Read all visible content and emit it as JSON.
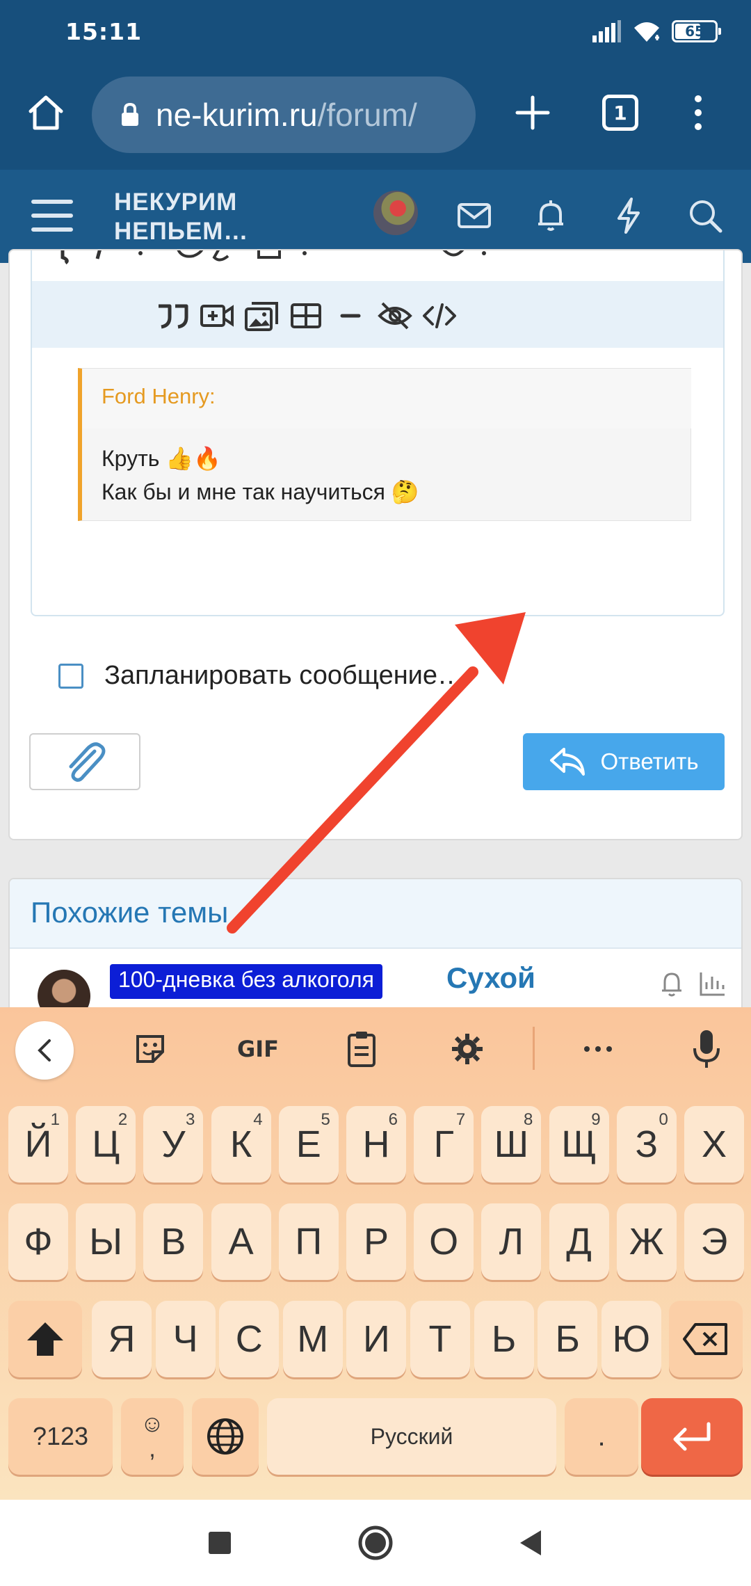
{
  "status": {
    "time": "15:11",
    "battery": "65",
    "battery_level": 0.65
  },
  "browser": {
    "url_host": "ne-kurim.ru",
    "url_path": "/forum/",
    "tab_count": "1"
  },
  "forum": {
    "logo_line1": "НЕКУРИМ",
    "logo_line2": "НЕПЬЕМ…"
  },
  "editor": {
    "quote_author": "Ford Henry:",
    "quote_line1": "Круть 👍🔥",
    "quote_line2": "Как бы и мне так научиться 🤔"
  },
  "form": {
    "schedule_label": "Запланировать сообщение…",
    "reply_label": "Ответить"
  },
  "similar": {
    "title": "Похожие темы",
    "thread_badge": "100-дневка без алкоголя",
    "thread_title": "Сухой"
  },
  "keyboard": {
    "toolbar_gif": "GIF",
    "row1": [
      {
        "k": "Й",
        "h": "1"
      },
      {
        "k": "Ц",
        "h": "2"
      },
      {
        "k": "У",
        "h": "3"
      },
      {
        "k": "К",
        "h": "4"
      },
      {
        "k": "Е",
        "h": "5"
      },
      {
        "k": "Н",
        "h": "6"
      },
      {
        "k": "Г",
        "h": "7"
      },
      {
        "k": "Ш",
        "h": "8"
      },
      {
        "k": "Щ",
        "h": "9"
      },
      {
        "k": "З",
        "h": "0"
      },
      {
        "k": "Х",
        "h": ""
      }
    ],
    "row2": [
      "Ф",
      "Ы",
      "В",
      "А",
      "П",
      "Р",
      "О",
      "Л",
      "Д",
      "Ж",
      "Э"
    ],
    "row3": [
      "Я",
      "Ч",
      "С",
      "М",
      "И",
      "Т",
      "Ь",
      "Б",
      "Ю"
    ],
    "symbols_label": "?123",
    "emoji_label": "☺",
    "comma_label": ",",
    "space_label": "Русский",
    "period_label": "."
  },
  "colors": {
    "header_bg": "#174f7c",
    "forum_bg": "#1c5a8a",
    "accent_blue": "#47a7eb",
    "quote_orange": "#f0a32b",
    "arrow_red": "#f0432e",
    "enter_key": "#ef6746"
  },
  "icons": {
    "browser": [
      "home-icon",
      "lock-icon",
      "plus-icon",
      "tabs-icon",
      "more-vertical-icon"
    ],
    "forum": [
      "hamburger-icon",
      "mail-icon",
      "bell-icon",
      "lightning-icon",
      "search-icon"
    ],
    "editor": [
      "quote-icon",
      "video-icon",
      "gallery-icon",
      "table-icon",
      "hr-icon",
      "hide-icon",
      "code-icon"
    ],
    "keyboard": [
      "chevron-left-icon",
      "sticker-icon",
      "clipboard-icon",
      "gear-icon",
      "more-horizontal-icon",
      "mic-icon",
      "shift-icon",
      "backspace-icon",
      "globe-icon",
      "enter-icon"
    ],
    "nav": [
      "recents-square-icon",
      "home-circle-icon",
      "back-triangle-icon"
    ]
  }
}
